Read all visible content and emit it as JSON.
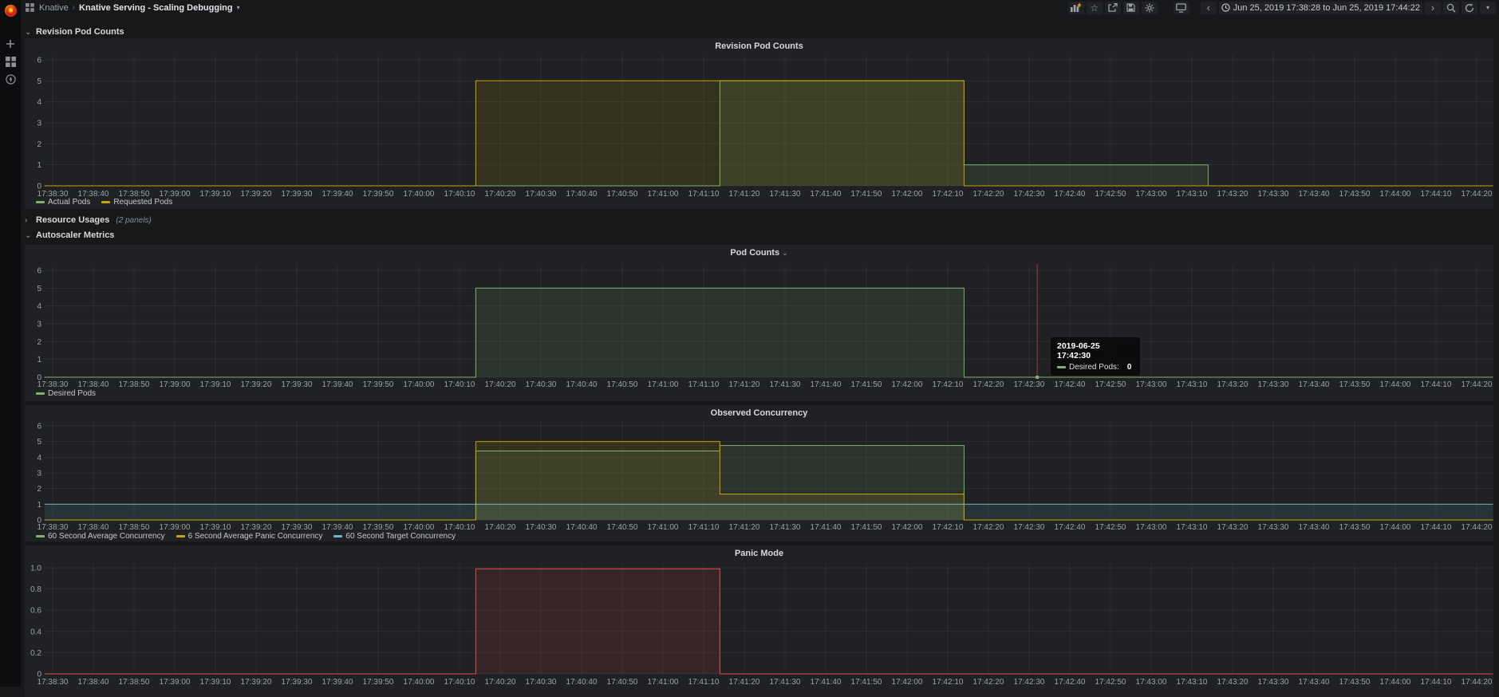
{
  "breadcrumb": {
    "parent": "Knative",
    "title": "Knative Serving - Scaling Debugging"
  },
  "toolbar": {
    "time_range": "Jun 25, 2019 17:38:28 to Jun 25, 2019 17:44:22",
    "icons": [
      "add-panel",
      "star",
      "share",
      "save",
      "settings",
      "cycle-view-mode",
      "time-step-back",
      "clock",
      "time-step-forward",
      "zoom-out",
      "refresh",
      "refresh-interval-caret"
    ]
  },
  "sidebar": {
    "icons": [
      "grafana-logo",
      "add",
      "dashboards",
      "explore"
    ]
  },
  "rows": [
    {
      "label": "Revision Pod Counts",
      "collapsed": false
    },
    {
      "label": "Resource Usages",
      "note": "(2 panels)",
      "collapsed": true
    },
    {
      "label": "Autoscaler Metrics",
      "collapsed": false
    }
  ],
  "tooltip": {
    "time": "2019-06-25 17:42:30",
    "series_label": "Desired Pods:",
    "value": "0",
    "series_color": "#7EB26D"
  },
  "colors": {
    "green": "#7EB26D",
    "yellow": "#CCA300",
    "blue": "#6CB5CC",
    "red": "#E24D42",
    "crosshair": "#a8343f",
    "grid": "rgba(255,255,255,0.055)",
    "axis_text": "#9ea1a6",
    "panel_bg": "#1f2124",
    "page_bg": "#17181a"
  },
  "x_ticks": [
    "17:38:30",
    "17:38:40",
    "17:38:50",
    "17:39:00",
    "17:39:10",
    "17:39:20",
    "17:39:30",
    "17:39:40",
    "17:39:50",
    "17:40:00",
    "17:40:10",
    "17:40:20",
    "17:40:30",
    "17:40:40",
    "17:40:50",
    "17:41:00",
    "17:41:10",
    "17:41:20",
    "17:41:30",
    "17:41:40",
    "17:41:50",
    "17:42:00",
    "17:42:10",
    "17:42:20",
    "17:42:30",
    "17:42:40",
    "17:42:50",
    "17:43:00",
    "17:43:10",
    "17:43:20",
    "17:43:30",
    "17:43:40",
    "17:43:50",
    "17:44:00",
    "17:44:10",
    "17:44:20"
  ],
  "chart_data": [
    {
      "type": "area",
      "title": "Revision Pod Counts",
      "ylim": [
        0,
        6
      ],
      "yticks": [
        0,
        1,
        2,
        3,
        4,
        5,
        6
      ],
      "ytick_labels": [
        "0",
        "1",
        "2",
        "3",
        "4",
        "5",
        "6"
      ],
      "xlabel": "",
      "ylabel": "",
      "legend_position": "bottom-left",
      "grid": true,
      "series": [
        {
          "name": "Actual Pods",
          "color": "#7EB26D",
          "points": [
            [
              -2,
              0
            ],
            [
              164,
              0
            ],
            [
              164,
              5
            ],
            [
              224,
              5
            ],
            [
              224,
              1
            ],
            [
              284,
              1
            ],
            [
              284,
              0
            ],
            [
              354,
              0
            ]
          ]
        },
        {
          "name": "Requested Pods",
          "color": "#CCA300",
          "points": [
            [
              -2,
              0
            ],
            [
              104,
              0
            ],
            [
              104,
              5
            ],
            [
              224,
              5
            ],
            [
              224,
              0
            ],
            [
              354,
              0
            ]
          ]
        }
      ]
    },
    {
      "type": "area",
      "title": "Pod Counts",
      "menu_caret": true,
      "ylim": [
        0,
        6
      ],
      "yticks": [
        0,
        1,
        2,
        3,
        4,
        5,
        6
      ],
      "ytick_labels": [
        "0",
        "1",
        "2",
        "3",
        "4",
        "5",
        "6"
      ],
      "xlabel": "",
      "ylabel": "",
      "legend_position": "bottom-left",
      "grid": true,
      "crosshair": {
        "t": 242,
        "value_at_crosshair": 0
      },
      "series": [
        {
          "name": "Desired Pods",
          "color": "#7EB26D",
          "points": [
            [
              -2,
              0
            ],
            [
              104,
              0
            ],
            [
              104,
              5
            ],
            [
              224,
              5
            ],
            [
              224,
              0
            ],
            [
              354,
              0
            ]
          ]
        }
      ]
    },
    {
      "type": "area",
      "title": "Observed Concurrency",
      "ylim": [
        0,
        6
      ],
      "yticks": [
        0,
        1,
        2,
        3,
        4,
        5,
        6
      ],
      "ytick_labels": [
        "0",
        "1",
        "2",
        "3",
        "4",
        "5",
        "6"
      ],
      "xlabel": "",
      "ylabel": "",
      "legend_position": "bottom-left",
      "grid": true,
      "series": [
        {
          "name": "60 Second Average Concurrency",
          "color": "#7EB26D",
          "points": [
            [
              -2,
              0
            ],
            [
              104,
              0
            ],
            [
              104,
              4.4
            ],
            [
              164,
              4.4
            ],
            [
              164,
              4.75
            ],
            [
              224,
              4.75
            ],
            [
              224,
              0
            ],
            [
              354,
              0
            ]
          ]
        },
        {
          "name": "6 Second Average Panic Concurrency",
          "color": "#CCA300",
          "points": [
            [
              -2,
              0
            ],
            [
              104,
              0
            ],
            [
              104,
              5
            ],
            [
              164,
              5
            ],
            [
              164,
              1.65
            ],
            [
              224,
              1.65
            ],
            [
              224,
              0
            ],
            [
              354,
              0
            ]
          ]
        },
        {
          "name": "60 Second Target Concurrency",
          "color": "#6CB5CC",
          "points": [
            [
              -2,
              1
            ],
            [
              354,
              1
            ]
          ]
        }
      ]
    },
    {
      "type": "area",
      "title": "Panic Mode",
      "ylim": [
        0,
        1
      ],
      "yticks": [
        0,
        0.2,
        0.4,
        0.6,
        0.8,
        1.0
      ],
      "ytick_labels": [
        "0",
        "0.2",
        "0.4",
        "0.6",
        "0.8",
        "1.0"
      ],
      "xlabel": "",
      "ylabel": "",
      "legend_position": "none",
      "grid": true,
      "series": [
        {
          "name": "Panic Mode",
          "color": "#E24D42",
          "points": [
            [
              -2,
              0
            ],
            [
              104,
              0
            ],
            [
              104,
              0.99
            ],
            [
              164,
              0.99
            ],
            [
              164,
              0
            ],
            [
              354,
              0
            ]
          ]
        }
      ]
    }
  ]
}
